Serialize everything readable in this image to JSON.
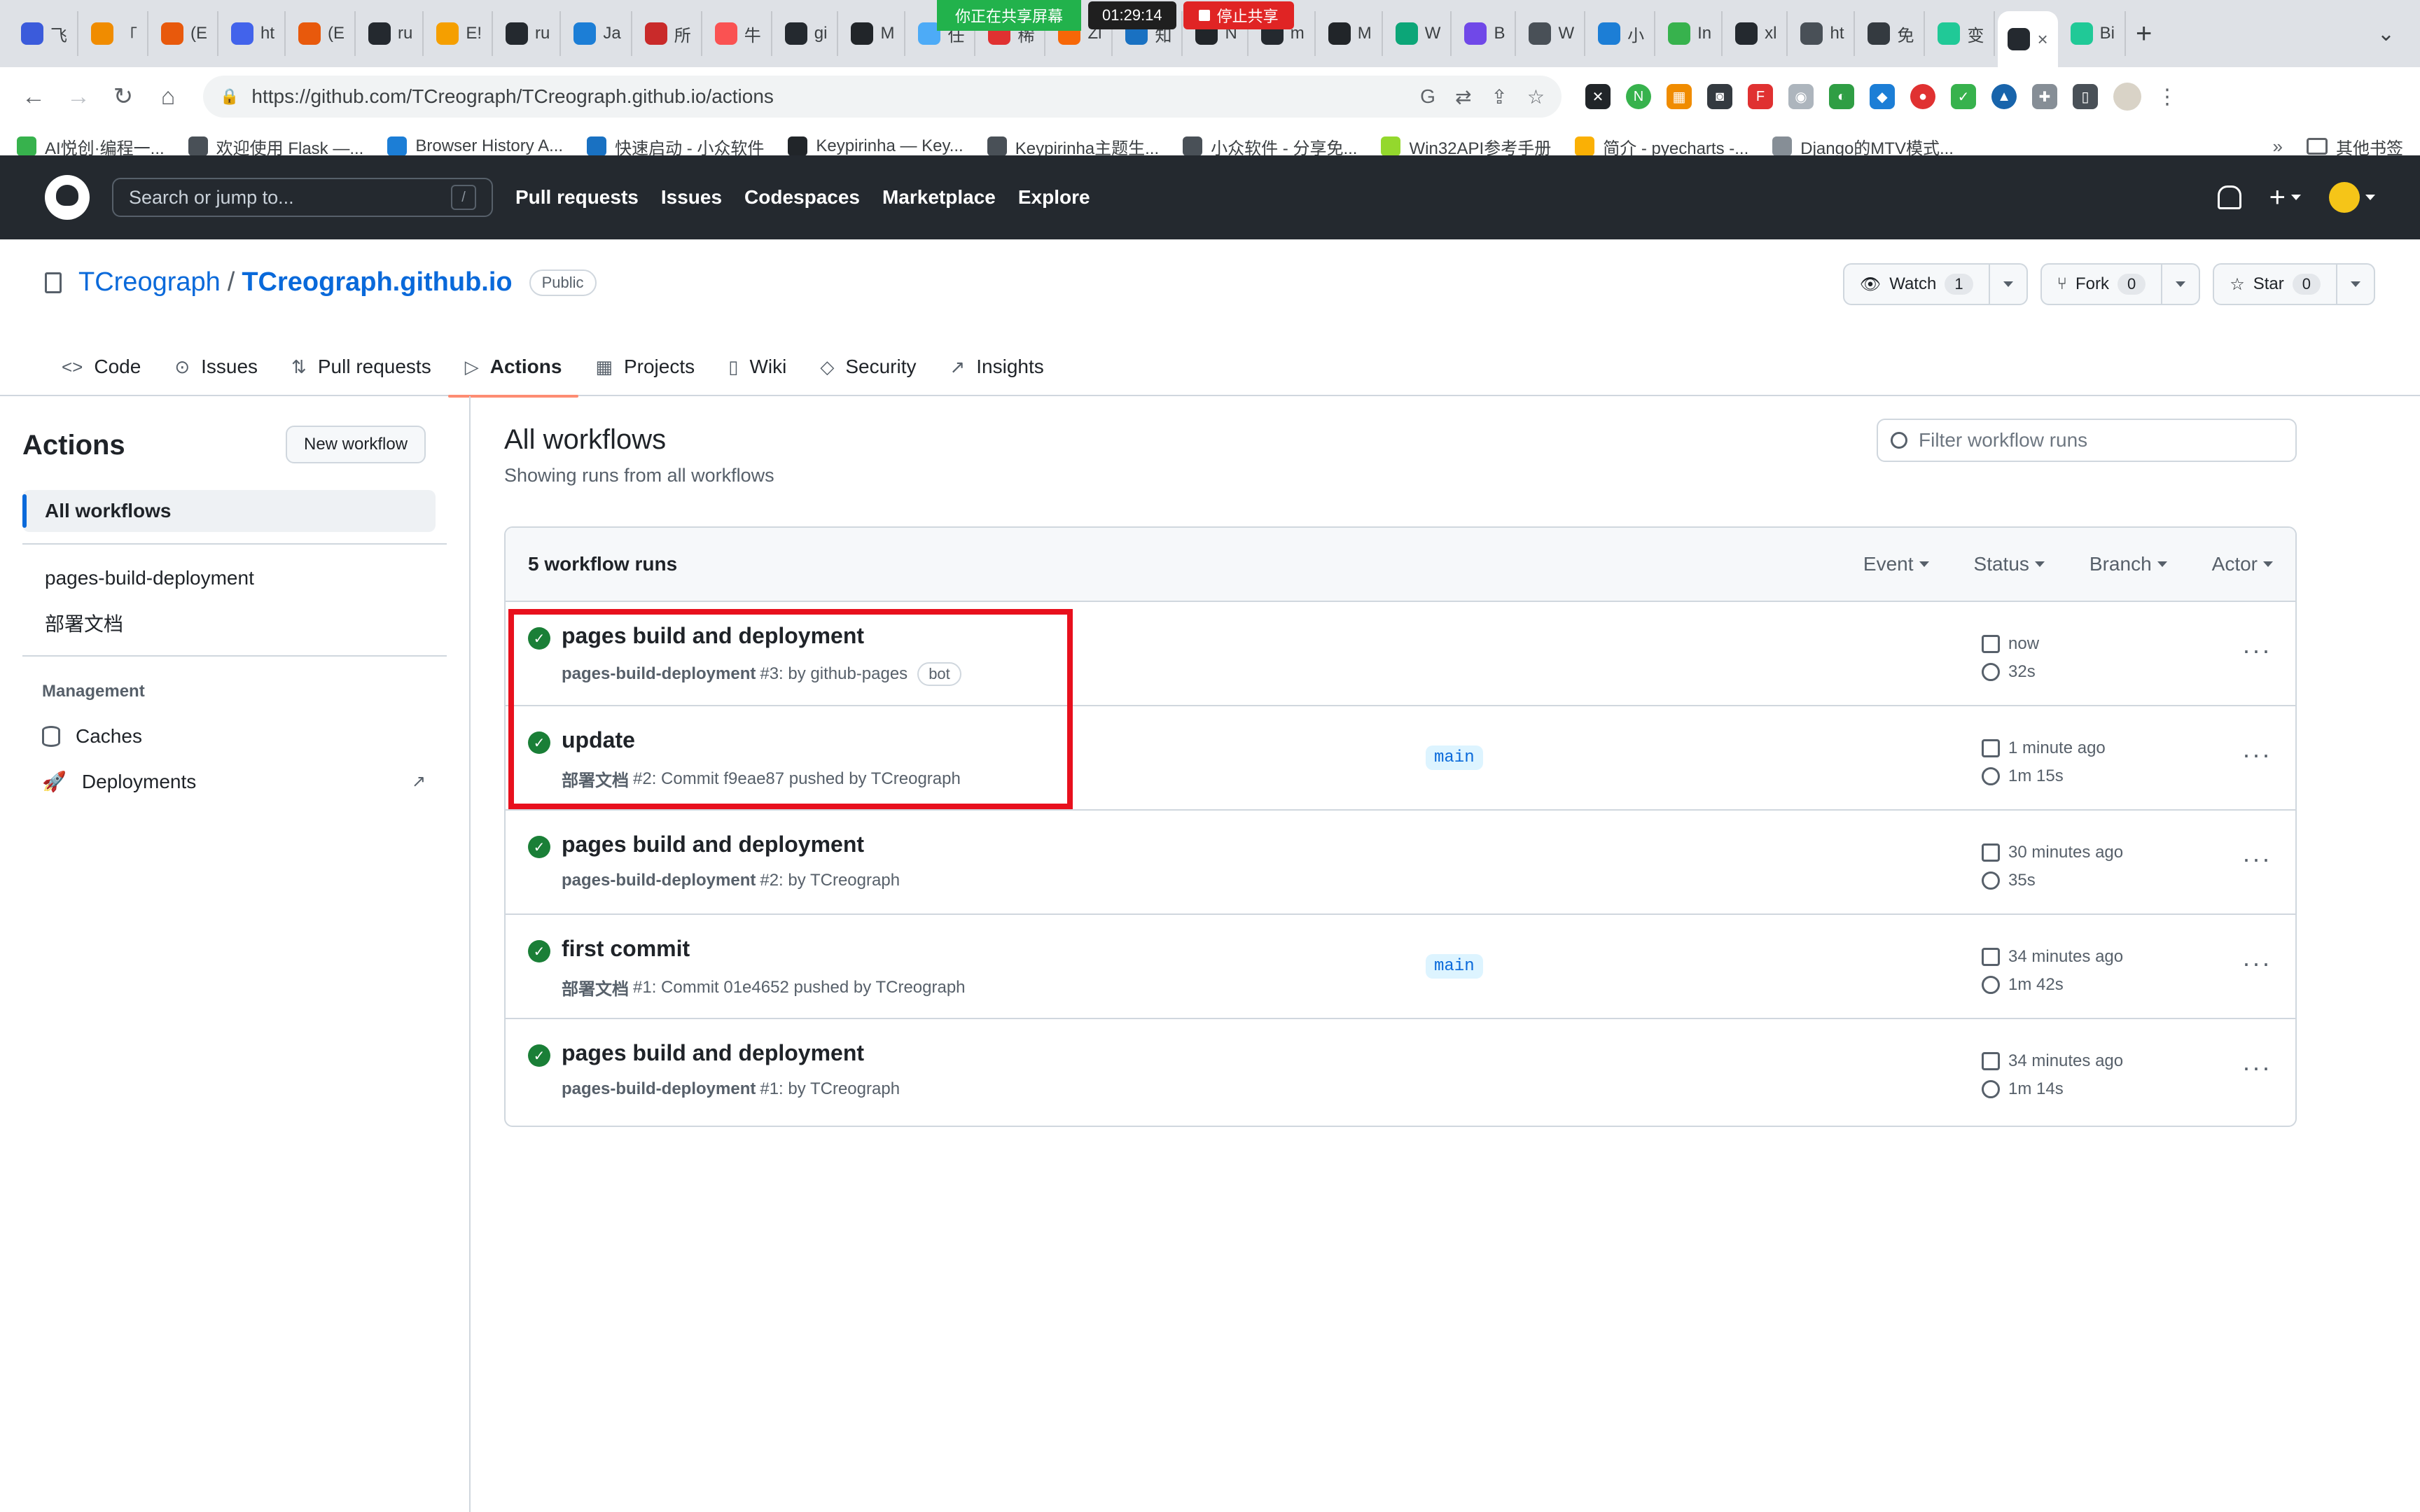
{
  "browser": {
    "tabs": [
      {
        "label": "飞",
        "color": "#3b5bdb"
      },
      {
        "label": "「",
        "color": "#f08c00"
      },
      {
        "label": "(E",
        "color": "#e8590c"
      },
      {
        "label": "ht",
        "color": "#4263eb"
      },
      {
        "label": "(E",
        "color": "#e8590c"
      },
      {
        "label": "ru",
        "color": "#24292f"
      },
      {
        "label": "E!",
        "color": "#f59f00"
      },
      {
        "label": "ru",
        "color": "#24292f"
      },
      {
        "label": "Ja",
        "color": "#1c7ed6"
      },
      {
        "label": "所",
        "color": "#c92a2a"
      },
      {
        "label": "牛",
        "color": "#fa5252"
      },
      {
        "label": "gi",
        "color": "#24292f"
      },
      {
        "label": "M",
        "color": "#212529"
      },
      {
        "label": "任",
        "color": "#4dabf7"
      },
      {
        "label": "稀",
        "color": "#e03131"
      },
      {
        "label": "Zi",
        "color": "#f76707"
      },
      {
        "label": "知",
        "color": "#1971c2"
      },
      {
        "label": "N",
        "color": "#212529"
      },
      {
        "label": "m",
        "color": "#24292f"
      },
      {
        "label": "M",
        "color": "#212529"
      },
      {
        "label": "W",
        "color": "#0ca678"
      },
      {
        "label": "B",
        "color": "#7048e8"
      },
      {
        "label": "W",
        "color": "#495057"
      },
      {
        "label": "小",
        "color": "#1c7ed6"
      },
      {
        "label": "In",
        "color": "#37b24d"
      },
      {
        "label": "xl",
        "color": "#24292f"
      },
      {
        "label": "ht",
        "color": "#495057"
      },
      {
        "label": "免",
        "color": "#343a40"
      },
      {
        "label": "变",
        "color": "#20c997"
      }
    ],
    "active_tab_close": "×",
    "last_tab": {
      "label": "Bi",
      "color": "#20c997"
    },
    "new_tab": "+",
    "tab_menu": "⌄",
    "sharing": {
      "text": "你正在共享屏幕",
      "timer": "01:29:14",
      "stop": "停止共享"
    },
    "url": "https://github.com/TCreograph/TCreograph.github.io/actions",
    "bookmarks": [
      {
        "label": "AI悦创·编程一...",
        "color": "#37b24d"
      },
      {
        "label": "欢迎使用 Flask —...",
        "color": "#495057"
      },
      {
        "label": "Browser History A...",
        "color": "#1c7ed6"
      },
      {
        "label": "快速启动 - 小众软件",
        "color": "#1971c2"
      },
      {
        "label": "Keypirinha — Key...",
        "color": "#212529"
      },
      {
        "label": "Keypirinha主题生...",
        "color": "#495057"
      },
      {
        "label": "小众软件 - 分享免...",
        "color": "#495057"
      },
      {
        "label": "Win32API参考手册",
        "color": "#94d82d"
      },
      {
        "label": "简介 - pyecharts -...",
        "color": "#fab005"
      },
      {
        "label": "Django的MTV模式...",
        "color": "#868e96"
      }
    ],
    "bookmarks_more": "»",
    "other_bookmarks": "其他书签"
  },
  "github": {
    "search_placeholder": "Search or jump to...",
    "search_shortcut": "/",
    "nav": [
      "Pull requests",
      "Issues",
      "Codespaces",
      "Marketplace",
      "Explore"
    ],
    "plus": "+"
  },
  "repo": {
    "owner": "TCreograph",
    "separator": "/",
    "name": "TCreograph.github.io",
    "visibility": "Public",
    "watch": {
      "label": "Watch",
      "count": "1"
    },
    "fork": {
      "label": "Fork",
      "count": "0"
    },
    "star": {
      "label": "Star",
      "count": "0"
    },
    "tabs": [
      {
        "label": "Code",
        "icon": "<>"
      },
      {
        "label": "Issues",
        "icon": "⊙"
      },
      {
        "label": "Pull requests",
        "icon": "⇅"
      },
      {
        "label": "Actions",
        "icon": "▷"
      },
      {
        "label": "Projects",
        "icon": "▦"
      },
      {
        "label": "Wiki",
        "icon": "▯"
      },
      {
        "label": "Security",
        "icon": "◇"
      },
      {
        "label": "Insights",
        "icon": "↗"
      }
    ]
  },
  "sidebar": {
    "title": "Actions",
    "new_workflow": "New workflow",
    "all_workflows": "All workflows",
    "workflows": [
      "pages-build-deployment",
      "部署文档"
    ],
    "management_label": "Management",
    "caches": "Caches",
    "deployments": "Deployments",
    "external_arrow": "↗"
  },
  "main": {
    "title": "All workflows",
    "subtitle": "Showing runs from all workflows",
    "filter_placeholder": "Filter workflow runs",
    "runs_count": "5 workflow runs",
    "filters": [
      "Event",
      "Status",
      "Branch",
      "Actor"
    ],
    "runs": [
      {
        "title": "pages build and deployment",
        "workflow": "pages-build-deployment",
        "meta": "#3: by github-pages",
        "bot": "bot",
        "branch": "",
        "when": "now",
        "duration": "32s"
      },
      {
        "title": "update",
        "workflow": "部署文档",
        "meta": "#2: Commit f9eae87 pushed by TCreograph",
        "bot": "",
        "branch": "main",
        "when": "1 minute ago",
        "duration": "1m 15s"
      },
      {
        "title": "pages build and deployment",
        "workflow": "pages-build-deployment",
        "meta": "#2: by TCreograph",
        "bot": "",
        "branch": "",
        "when": "30 minutes ago",
        "duration": "35s"
      },
      {
        "title": "first commit",
        "workflow": "部署文档",
        "meta": "#1: Commit 01e4652 pushed by TCreograph",
        "bot": "",
        "branch": "main",
        "when": "34 minutes ago",
        "duration": "1m 42s"
      },
      {
        "title": "pages build and deployment",
        "workflow": "pages-build-deployment",
        "meta": "#1: by TCreograph",
        "bot": "",
        "branch": "",
        "when": "34 minutes ago",
        "duration": "1m 14s"
      }
    ],
    "more": "···",
    "check": "✓"
  },
  "colors": {
    "accent": "#0969da",
    "success": "#1a7f37",
    "highlight": "#e8101d",
    "header_bg": "#24292f"
  }
}
